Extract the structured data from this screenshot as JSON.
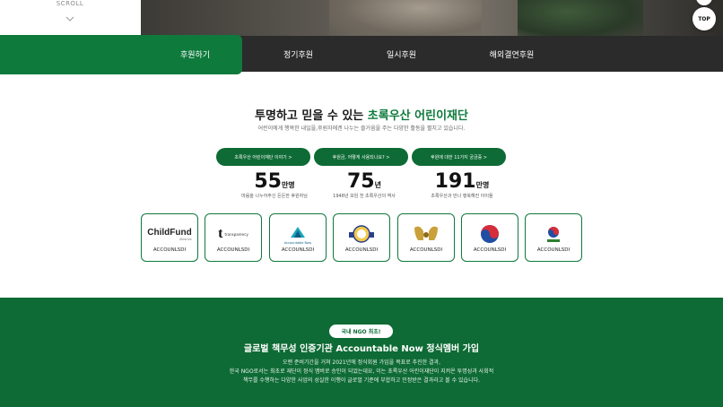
{
  "hero": {
    "scroll_label": "SCROLL",
    "top_button": "TOP"
  },
  "tabs": [
    {
      "label": "후원하기",
      "active": true
    },
    {
      "label": "정기후원"
    },
    {
      "label": "일시후원"
    },
    {
      "label": "해외결연후원"
    }
  ],
  "intro": {
    "title_prefix": "투명하고 믿을 수 있는",
    "title_accent": "초록우산 어린이재단",
    "subtitle": "어린이에게 행복한 내일을,후원자에겐 나누는 즐거움을 주는 다양한 활동을 펼치고 있습니다."
  },
  "pills": [
    "초록우산 어린이재단 이야기 >",
    "후원금, 어떻게 사용되나요? >",
    "후원에 대한 11가지 궁금증 >"
  ],
  "stats": [
    {
      "number": "55",
      "unit": "만명",
      "desc": "마음을 나누어주신 든든한 후원자님"
    },
    {
      "number": "75",
      "unit": "년",
      "desc": "1948년 모임 천 초록우산의 역사"
    },
    {
      "number": "191",
      "unit": "만명",
      "desc": "초록우산과 만나 행복해진 아이들"
    }
  ],
  "cards": [
    {
      "logo": "ChildFund",
      "logo_sub": "Alliance",
      "caption": "ACCOUNLSDI"
    },
    {
      "logo": "t",
      "logo_sub": "transparency",
      "caption": "ACCOUNLSDI"
    },
    {
      "logo": "Accountable Now",
      "caption": "ACCOUNLSDI"
    },
    {
      "logo": "emblem-badge",
      "caption": "ACCOUNLSDI"
    },
    {
      "logo": "phoenix-emblem",
      "caption": "ACCOUNLSDI"
    },
    {
      "logo": "taegeuk-emblem",
      "caption": "ACCOUNLSDI"
    },
    {
      "logo": "government-seal",
      "caption": "ACCOUNLSDI"
    }
  ],
  "green": {
    "badge": "국내 NGO 최초!",
    "title": "글로벌 책무성 인증기관 Accountable Now 정식멤버 가입",
    "body_line1": "오랜 준비기간을 거쳐 2021년에 정식회원 가입을 목표로 추진한 결과,",
    "body_line2": "한국 NGO로서는 최초로 재단이 정식 멤버로 승인이 되었는데요, 이는 초록우산 어린이재단이 지켜온 투명성과 사회적",
    "body_line3": "책무를 수행하는 다양한 사업의 성실한 이행이 글로벌 기준에 부합하고 인정받은 결과라고 볼 수 있습니다."
  },
  "colors": {
    "brand_green": "#0e7a3c",
    "dark_green": "#0e6b35",
    "tabbar": "#2b2b2b"
  }
}
